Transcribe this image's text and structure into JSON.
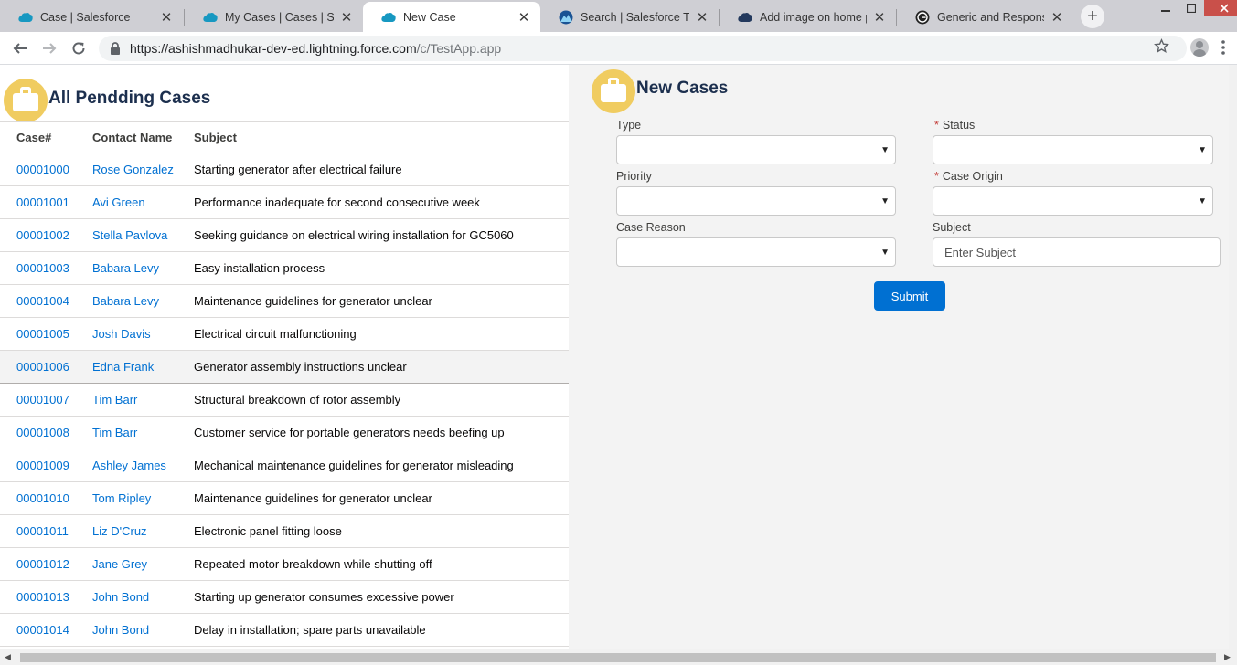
{
  "browser": {
    "tabs": [
      {
        "title": "Case | Salesforce",
        "favicon": "salesforce-cloud-icon",
        "active": false
      },
      {
        "title": "My Cases | Cases | Salesforce",
        "favicon": "salesforce-cloud-icon",
        "active": false
      },
      {
        "title": "New Case",
        "favicon": "salesforce-cloud-icon",
        "active": true
      },
      {
        "title": "Search | Salesforce Trailhead",
        "favicon": "trailhead-icon",
        "active": false
      },
      {
        "title": "Add image on home page",
        "favicon": "cloud-dark-icon",
        "active": false
      },
      {
        "title": "Generic and Responsive",
        "favicon": "ge-logo-icon",
        "active": false
      }
    ],
    "close_glyph": "✕",
    "new_tab_glyph": "+",
    "url_host": "https://ashishmadhukar-dev-ed.lightning.force.com",
    "url_path": "/c/TestApp.app"
  },
  "cases_list": {
    "title": "All Pendding Cases",
    "columns": [
      "Case#",
      "Contact Name",
      "Subject"
    ],
    "rows": [
      {
        "case": "00001000",
        "contact": "Rose Gonzalez",
        "subject": "Starting generator after electrical failure"
      },
      {
        "case": "00001001",
        "contact": "Avi Green",
        "subject": "Performance inadequate for second consecutive week"
      },
      {
        "case": "00001002",
        "contact": "Stella Pavlova",
        "subject": "Seeking guidance on electrical wiring installation for GC5060"
      },
      {
        "case": "00001003",
        "contact": "Babara Levy",
        "subject": "Easy installation process"
      },
      {
        "case": "00001004",
        "contact": "Babara Levy",
        "subject": "Maintenance guidelines for generator unclear"
      },
      {
        "case": "00001005",
        "contact": "Josh Davis",
        "subject": "Electrical circuit malfunctioning"
      },
      {
        "case": "00001006",
        "contact": "Edna Frank",
        "subject": "Generator assembly instructions unclear"
      },
      {
        "case": "00001007",
        "contact": "Tim Barr",
        "subject": "Structural breakdown of rotor assembly"
      },
      {
        "case": "00001008",
        "contact": "Tim Barr",
        "subject": "Customer service for portable generators needs beefing up"
      },
      {
        "case": "00001009",
        "contact": "Ashley James",
        "subject": "Mechanical maintenance guidelines for generator misleading"
      },
      {
        "case": "00001010",
        "contact": "Tom Ripley",
        "subject": "Maintenance guidelines for generator unclear"
      },
      {
        "case": "00001011",
        "contact": "Liz D'Cruz",
        "subject": "Electronic panel fitting loose"
      },
      {
        "case": "00001012",
        "contact": "Jane Grey",
        "subject": "Repeated motor breakdown while shutting off"
      },
      {
        "case": "00001013",
        "contact": "John Bond",
        "subject": "Starting up generator consumes excessive power"
      },
      {
        "case": "00001014",
        "contact": "John Bond",
        "subject": "Delay in installation; spare parts unavailable"
      }
    ]
  },
  "new_case_form": {
    "title": "New Cases",
    "required_marker": "*",
    "type_label": "Type",
    "status_label": "Status",
    "priority_label": "Priority",
    "origin_label": "Case Origin",
    "reason_label": "Case Reason",
    "subject_label": "Subject",
    "subject_placeholder": "Enter Subject",
    "submit_label": "Submit"
  },
  "colors": {
    "brand_blue": "#0070d2",
    "case_icon": "#f0cc60",
    "heading": "#1c2f4e"
  }
}
